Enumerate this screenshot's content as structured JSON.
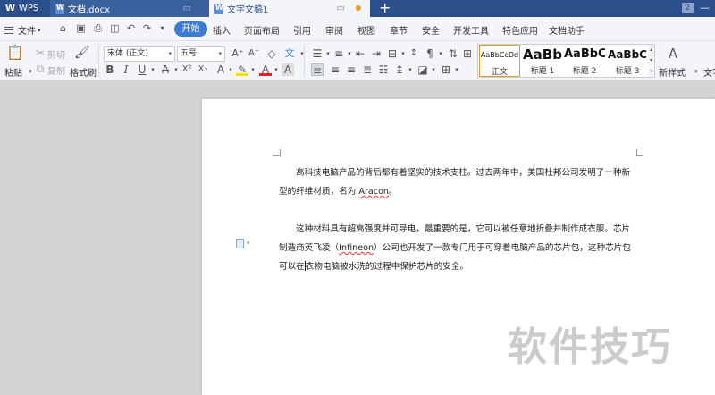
{
  "tabs": [
    {
      "label": "WPS"
    },
    {
      "label": "文档.docx"
    },
    {
      "label": "文字文稿1"
    }
  ],
  "window": {
    "badge": "2"
  },
  "menu": {
    "file": "文件",
    "items": [
      "开始",
      "插入",
      "页面布局",
      "引用",
      "审阅",
      "视图",
      "章节",
      "安全",
      "开发工具",
      "特色应用",
      "文档助手"
    ]
  },
  "ribbon": {
    "paste": "粘贴",
    "cut": "剪切",
    "copy": "复制",
    "format_painter": "格式刷",
    "font_name": "宋体 (正文)",
    "font_size": "五号",
    "styles": [
      {
        "sample": "AaBbCcDd",
        "name": "正文"
      },
      {
        "sample": "AaBb",
        "name": "标题 1"
      },
      {
        "sample": "AaBbC",
        "name": "标题 2"
      },
      {
        "sample": "AaBbC",
        "name": "标题 3"
      }
    ],
    "new_style": "新样式",
    "text_tool": "文字"
  },
  "document": {
    "para1_a": "高科技电脑产品的背后都有着坚实的技术支柱。过去两年中，美国杜邦公司发明了一种新型的纤维材质，名为 ",
    "para1_word": "Aracon",
    "para1_b": "。",
    "para2_a": "这种材料具有超高强度并可导电，最重要的是，它可以被任意地折叠并制作成衣服。芯片制造商英飞凌（",
    "para2_word": "Infineon",
    "para2_b": "）公司也开发了一款专门用于可穿着电脑产品的芯片包，这种芯片包可以在",
    "para2_c": "衣物电脑被水洗的过程中保护芯片的安全。"
  },
  "watermark": "软件技巧",
  "colors": {
    "tabbar": "#2b4f8a",
    "accent": "#3a7bd5",
    "modified_dot": "#e8a02a"
  }
}
